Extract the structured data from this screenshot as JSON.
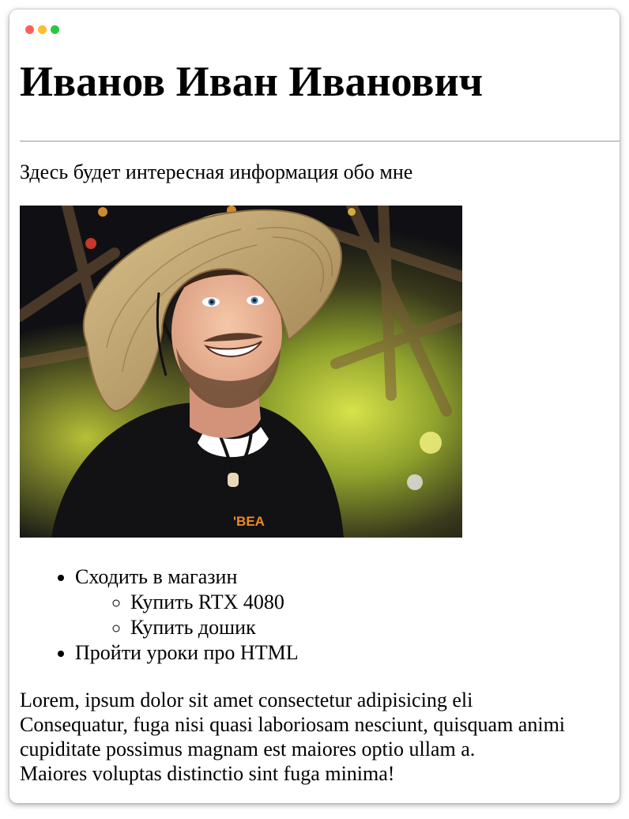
{
  "window": {
    "controls": [
      "close",
      "minimize",
      "maximize"
    ]
  },
  "page": {
    "title": "Иванов Иван Иванович",
    "intro": "Здесь будет интересная информация обо мне",
    "photo": {
      "icon": "portrait-photo"
    },
    "todo": [
      {
        "label": "Сходить в магазин",
        "children": [
          "Купить RTX 4080",
          "Купить дошик"
        ]
      },
      {
        "label": "Пройти уроки про HTML",
        "children": []
      }
    ],
    "paragraph_lines": [
      "Lorem, ipsum dolor sit amet consectetur adipisicing eli",
      "Consequatur, fuga nisi quasi laboriosam nesciunt, quisquam animi",
      "cupiditate possimus magnam est maiores optio ullam a.",
      "Maiores voluptas distinctio sint fuga minima!"
    ]
  },
  "colors": {
    "close": "#ff5f57",
    "minimize": "#febc2e",
    "maximize": "#28c840",
    "rule": "#9a9a9a"
  }
}
